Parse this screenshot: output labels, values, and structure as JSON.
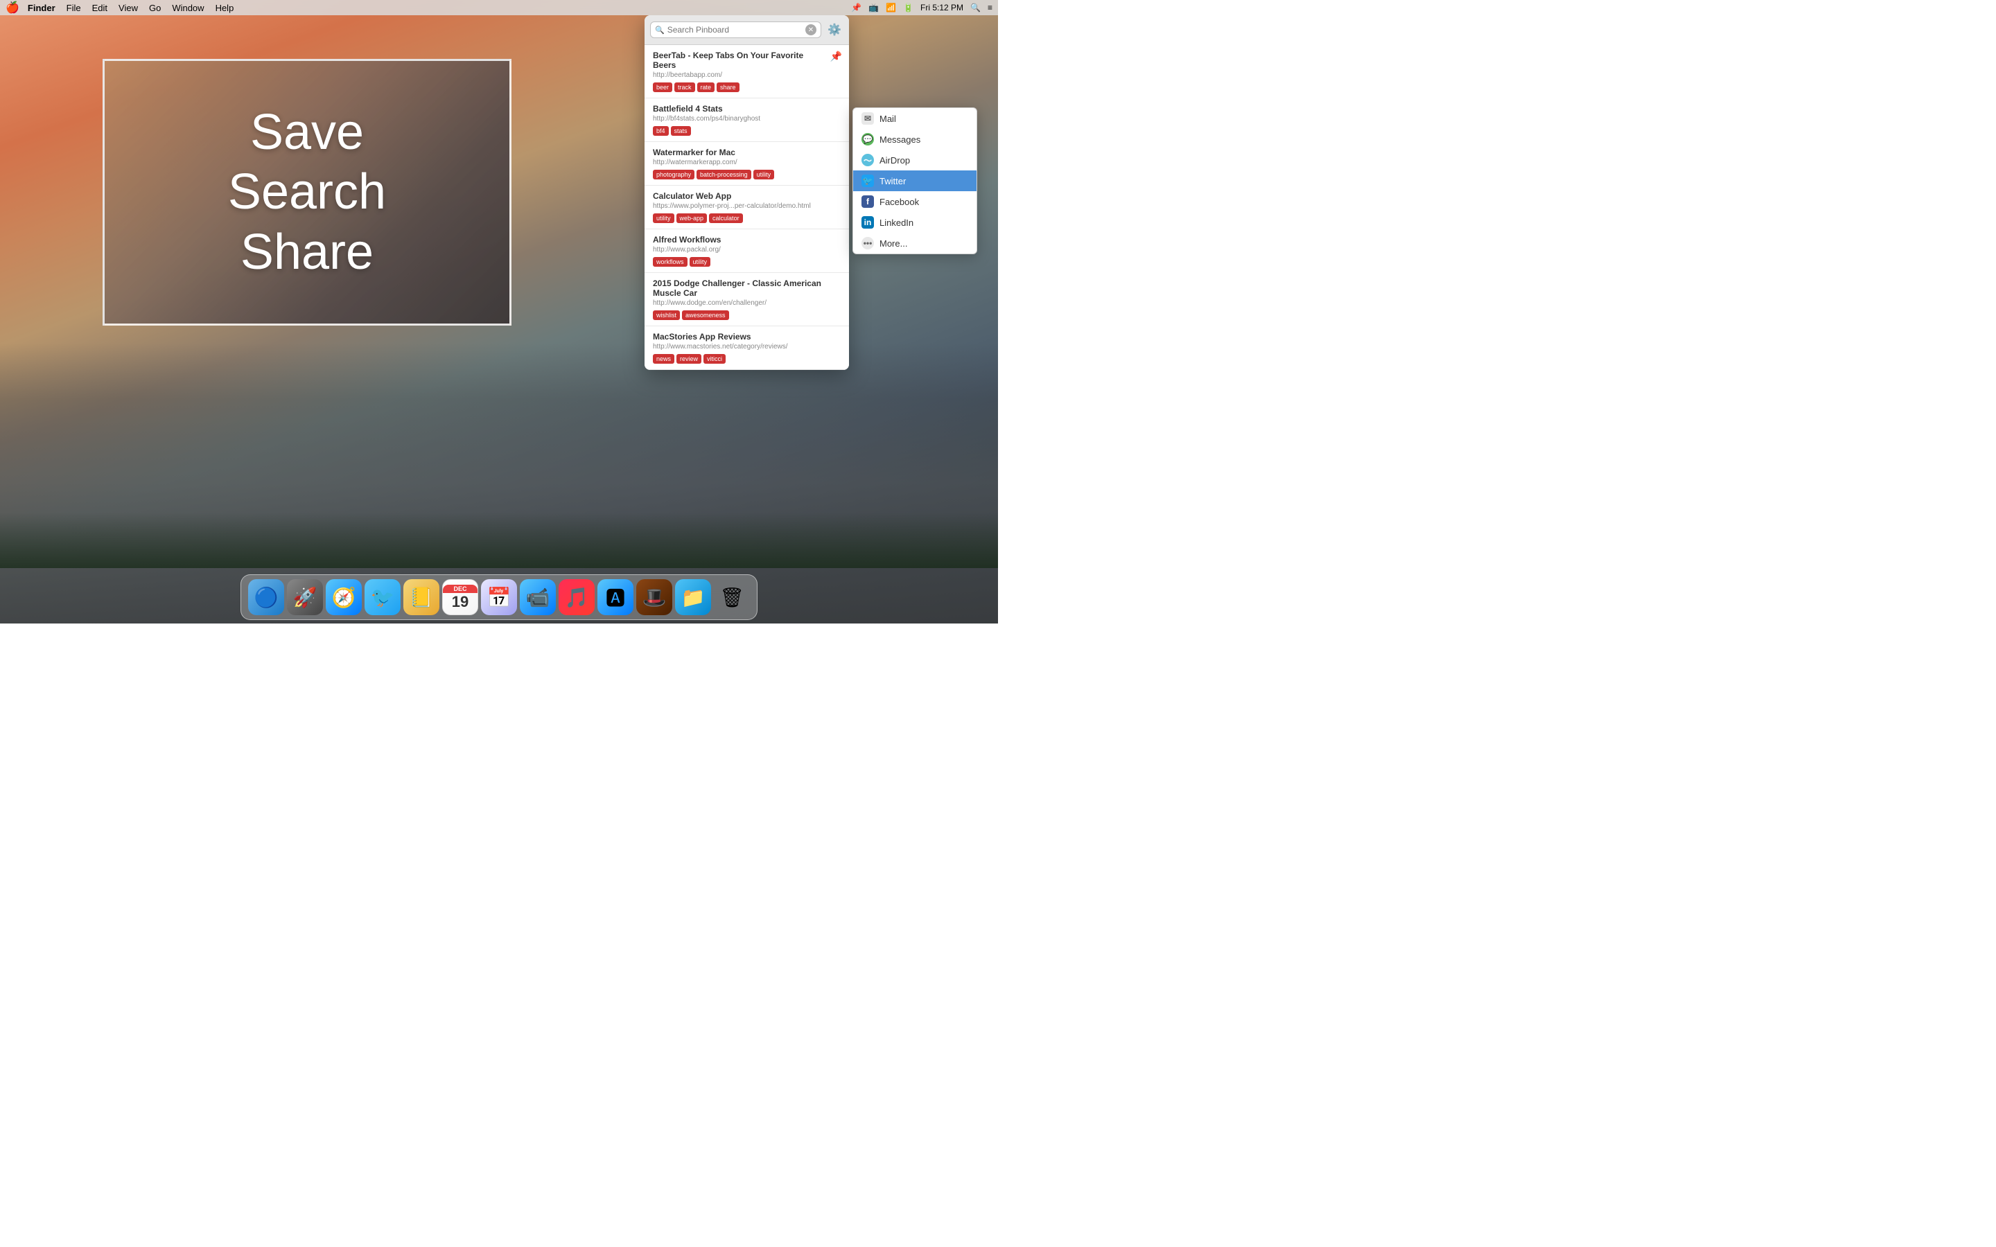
{
  "menubar": {
    "apple": "🍎",
    "app_name": "Finder",
    "menus": [
      "File",
      "Edit",
      "View",
      "Go",
      "Window",
      "Help"
    ],
    "right": {
      "time": "Fri 5:12 PM"
    }
  },
  "promo": {
    "lines": [
      "Save",
      "Search",
      "Share"
    ]
  },
  "pinboard": {
    "search_placeholder": "Search Pinboard",
    "items": [
      {
        "title": "BeerTab - Keep Tabs On Your Favorite Beers",
        "url": "http://beertabapp.com/",
        "tags": [
          "beer",
          "track",
          "rate",
          "share"
        ],
        "pinned": true
      },
      {
        "title": "Battlefield 4 Stats",
        "url": "http://bf4stats.com/ps4/binaryghost",
        "tags": [
          "bf4",
          "stats"
        ],
        "pinned": false
      },
      {
        "title": "Watermarker for Mac",
        "url": "http://watermarkerapp.com/",
        "tags": [
          "photography",
          "batch-processing",
          "utility"
        ],
        "pinned": false
      },
      {
        "title": "Calculator Web App",
        "url": "https://www.polymer-proj...per-calculator/demo.html",
        "tags": [
          "utility",
          "web-app",
          "calculator"
        ],
        "pinned": false
      },
      {
        "title": "Alfred Workflows",
        "url": "http://www.packal.org/",
        "tags": [
          "workflows",
          "utility"
        ],
        "pinned": false
      },
      {
        "title": "2015 Dodge Challenger - Classic American Muscle Car",
        "url": "http://www.dodge.com/en/challenger/",
        "tags": [
          "wishlist",
          "awesomeness"
        ],
        "pinned": false
      },
      {
        "title": "MacStories App Reviews",
        "url": "http://www.macstories.net/category/reviews/",
        "tags": [
          "news",
          "review",
          "viticci"
        ],
        "pinned": false
      }
    ]
  },
  "share_menu": {
    "items": [
      {
        "label": "Mail",
        "icon": "mail",
        "symbol": "✉"
      },
      {
        "label": "Messages",
        "icon": "messages",
        "symbol": "💬"
      },
      {
        "label": "AirDrop",
        "icon": "airdrop",
        "symbol": "📡"
      },
      {
        "label": "Twitter",
        "icon": "twitter",
        "symbol": "🐦",
        "active": true
      },
      {
        "label": "Facebook",
        "icon": "facebook",
        "symbol": "f"
      },
      {
        "label": "LinkedIn",
        "icon": "linkedin",
        "symbol": "in"
      },
      {
        "label": "More...",
        "icon": "more",
        "symbol": "•••"
      }
    ]
  },
  "dock": {
    "items": [
      {
        "label": "Finder",
        "bg": "finder-bg",
        "symbol": "🔵"
      },
      {
        "label": "Launchpad",
        "bg": "rocket-bg",
        "symbol": "🚀"
      },
      {
        "label": "Safari",
        "bg": "safari-bg",
        "symbol": "🧭"
      },
      {
        "label": "Twitterific",
        "bg": "twitterific-bg",
        "symbol": "🐦"
      },
      {
        "label": "Contacts",
        "bg": "contacts-bg",
        "symbol": "📒"
      },
      {
        "label": "Calendar",
        "bg": "calendar-bg",
        "date_month": "DEC",
        "date_day": "19"
      },
      {
        "label": "Fantastical",
        "bg": "fantastical-bg",
        "symbol": "📅"
      },
      {
        "label": "FaceTime",
        "bg": "facetime-bg",
        "symbol": "📹"
      },
      {
        "label": "Music",
        "bg": "music-bg",
        "symbol": "🎵"
      },
      {
        "label": "App Store",
        "bg": "appstore-bg",
        "symbol": "🅰"
      },
      {
        "label": "Alfred",
        "bg": "detective-bg",
        "symbol": "🎩"
      },
      {
        "label": "Files",
        "bg": "files-bg",
        "symbol": "📁"
      },
      {
        "label": "Trash",
        "bg": "trash-bg",
        "symbol": "🗑"
      }
    ]
  }
}
